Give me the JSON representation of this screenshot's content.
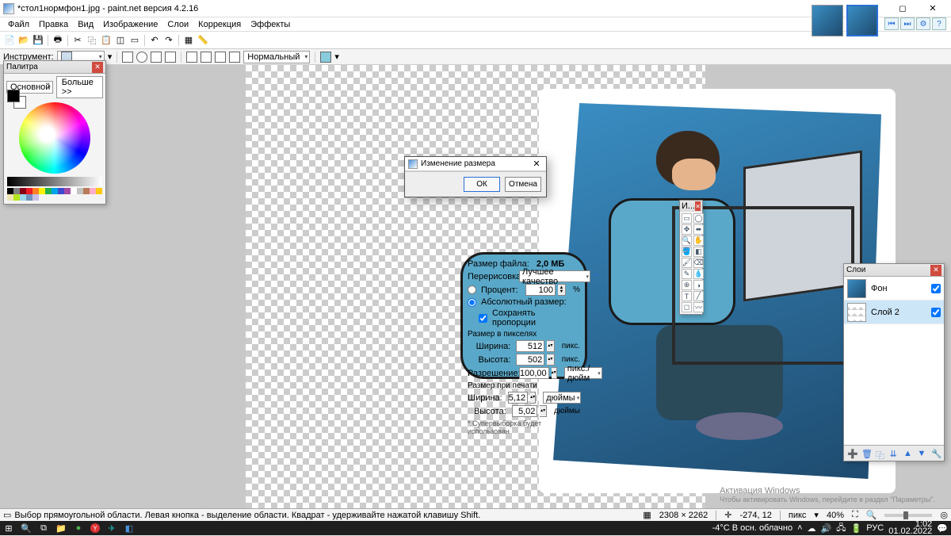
{
  "title": "*стол1нормфон1.jpg - paint.net версия 4.2.16",
  "menu": [
    "Файл",
    "Правка",
    "Вид",
    "Изображение",
    "Слои",
    "Коррекция",
    "Эффекты"
  ],
  "toolopts": {
    "label": "Инструмент:",
    "mode": "Нормальный"
  },
  "nav": [
    "⏮",
    "⏭",
    "⚙",
    "?"
  ],
  "palette": {
    "title": "Палитра",
    "primary": "Основной",
    "more": "Больше >>"
  },
  "tools_title": "И...",
  "layers": {
    "title": "Слои",
    "items": [
      {
        "name": "Фон",
        "checked": true,
        "sel": false
      },
      {
        "name": "Слой 2",
        "checked": true,
        "sel": true
      }
    ]
  },
  "dialog": {
    "title": "Изменение размера",
    "filesize_label": "Размер файла:",
    "filesize": "2,0 МБ",
    "resample_label": "Перерисовка:",
    "resample": "Лучшее качество",
    "percent_label": "Процент:",
    "percent": "100",
    "percent_unit": "%",
    "absolute_label": "Абсолютный размер:",
    "keep_aspect": "Сохранять пропорции",
    "pixel_section": "Размер в пикселях",
    "width_label": "Ширина:",
    "width_px": "512",
    "px_unit": "пикс.",
    "height_label": "Высота:",
    "height_px": "502",
    "res_label": "Разрешение:",
    "res": "100,00",
    "res_unit": "пикс./дюйм",
    "print_section": "Размер при печати",
    "width_in": "5,12",
    "height_in": "5,02",
    "in_unit": "дюймы",
    "note": "* Супервыборка будет использован",
    "ok": "ОК",
    "cancel": "Отмена"
  },
  "status": {
    "hint": "Выбор прямоугольной области. Левая кнопка - выделение области. Квадрат - удерживайте нажатой клавишу Shift.",
    "dims": "2308 × 2262",
    "coords": "-274, 12",
    "unit": "пикс",
    "zoom": "40%"
  },
  "watermark": {
    "t": "Активация Windows",
    "s": "Чтобы активировать Windows, перейдите в раздел \"Параметры\"."
  },
  "taskbar": {
    "weather": "-4°C  В осн. облачно",
    "lang": "РУС",
    "time": "1:02",
    "date": "01.02.2022"
  },
  "palette_colors": [
    "#000",
    "#7f7f7f",
    "#880015",
    "#ed1c24",
    "#ff7f27",
    "#fff200",
    "#22b14c",
    "#00a2e8",
    "#3f48cc",
    "#a349a4",
    "#fff",
    "#c3c3c3",
    "#b97a57",
    "#ffaec9",
    "#ffc90e",
    "#efe4b0",
    "#b5e61d",
    "#99d9ea",
    "#7092be",
    "#c8bfe7"
  ]
}
